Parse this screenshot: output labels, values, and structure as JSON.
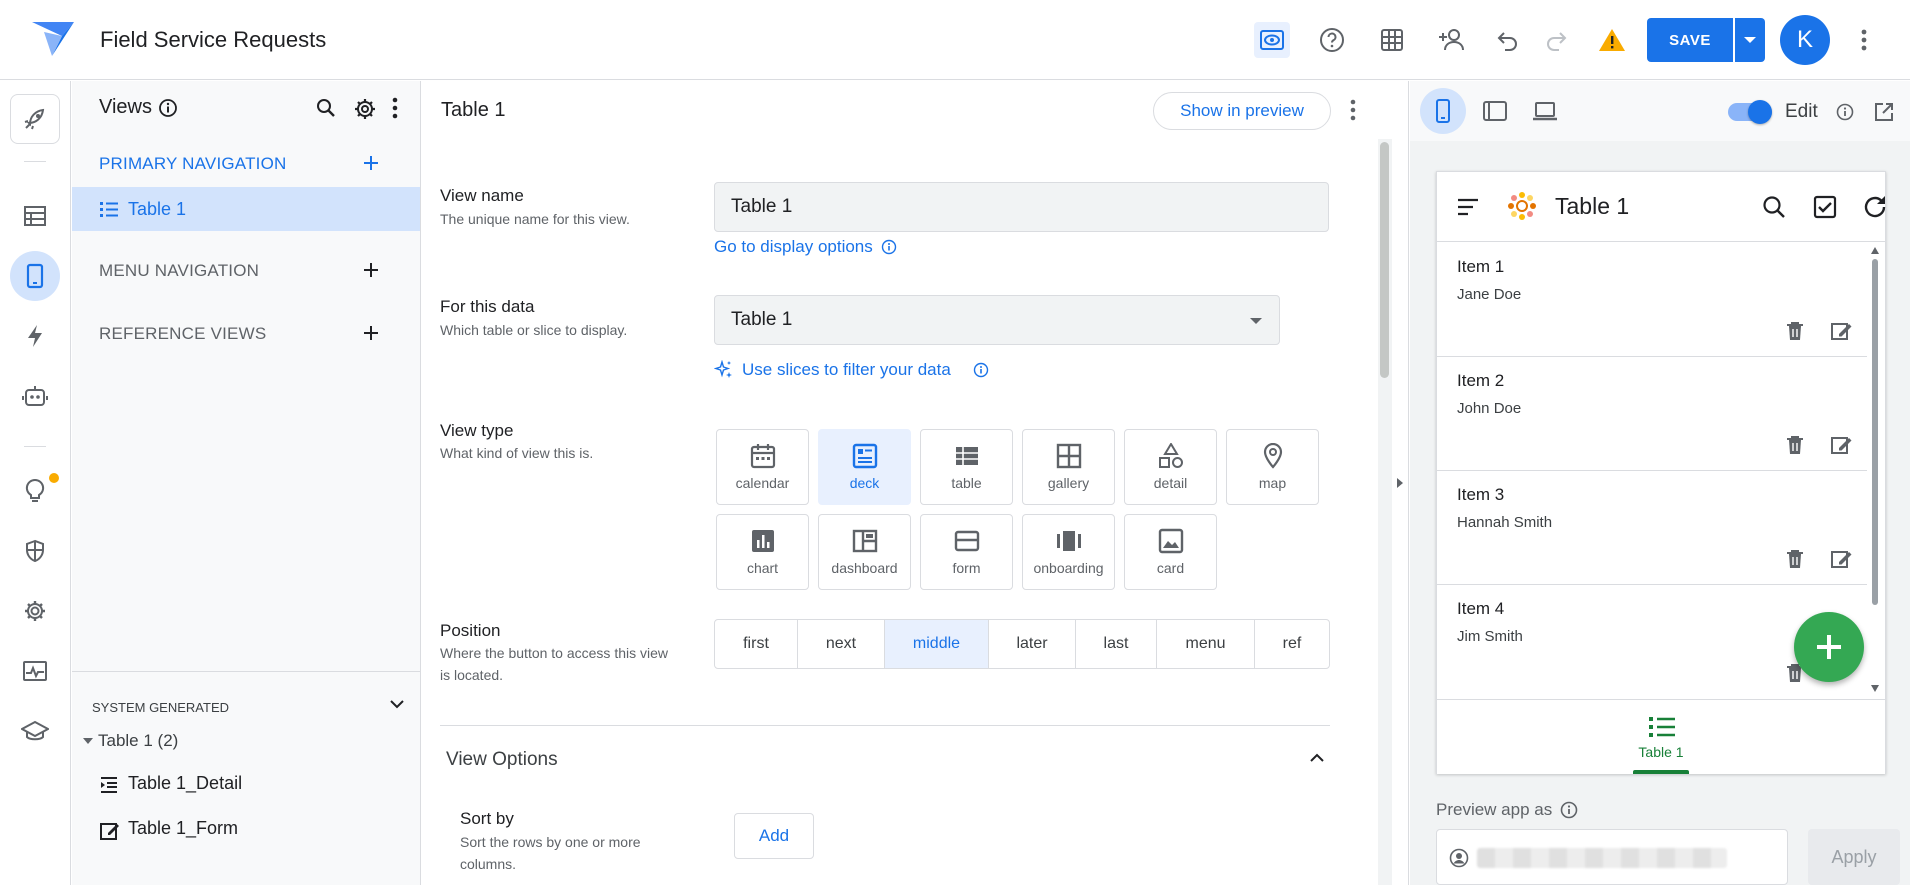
{
  "app": {
    "title": "Field Service Requests",
    "save_label": "SAVE",
    "avatar_initial": "K"
  },
  "views_panel": {
    "title": "Views",
    "sections": {
      "primary": "PRIMARY NAVIGATION",
      "menu": "MENU NAVIGATION",
      "reference": "REFERENCE VIEWS"
    },
    "primary_items": [
      {
        "label": "Table 1"
      }
    ],
    "system_generated": {
      "title": "SYSTEM GENERATED",
      "group": "Table 1 (2)",
      "items": [
        {
          "label": "Table 1_Detail"
        },
        {
          "label": "Table 1_Form"
        }
      ]
    }
  },
  "editor": {
    "title": "Table 1",
    "show_in_preview": "Show in preview",
    "view_name": {
      "label": "View name",
      "help": "The unique name for this view.",
      "value": "Table 1",
      "link": "Go to display options"
    },
    "for_data": {
      "label": "For this data",
      "help": "Which table or slice to display.",
      "value": "Table 1",
      "link": "Use slices to filter your data"
    },
    "view_type": {
      "label": "View type",
      "help": "What kind of view this is.",
      "selected": "deck",
      "options": [
        "calendar",
        "deck",
        "table",
        "gallery",
        "detail",
        "map",
        "chart",
        "dashboard",
        "form",
        "onboarding",
        "card"
      ]
    },
    "position": {
      "label": "Position",
      "help": "Where the button to access this view is located.",
      "selected": "middle",
      "options": [
        "first",
        "next",
        "middle",
        "later",
        "last",
        "menu",
        "ref"
      ]
    },
    "view_options": {
      "title": "View Options"
    },
    "sort_by": {
      "label": "Sort by",
      "help": "Sort the rows by one or more columns.",
      "button": "Add"
    }
  },
  "preview": {
    "edit_label": "Edit",
    "edit_on": true,
    "app_title": "Table 1",
    "items": [
      {
        "title": "Item 1",
        "subtitle": "Jane Doe"
      },
      {
        "title": "Item 2",
        "subtitle": "John Doe"
      },
      {
        "title": "Item 3",
        "subtitle": "Hannah Smith"
      },
      {
        "title": "Item 4",
        "subtitle": "Jim Smith"
      }
    ],
    "bottom_nav_label": "Table 1",
    "preview_as_label": "Preview app as",
    "apply_label": "Apply"
  },
  "colors": {
    "accent": "#1a73e8",
    "selected_bg": "#d2e3fc",
    "fab": "#34a853",
    "warning": "#f9ab00",
    "dot": "#f9ab00"
  }
}
